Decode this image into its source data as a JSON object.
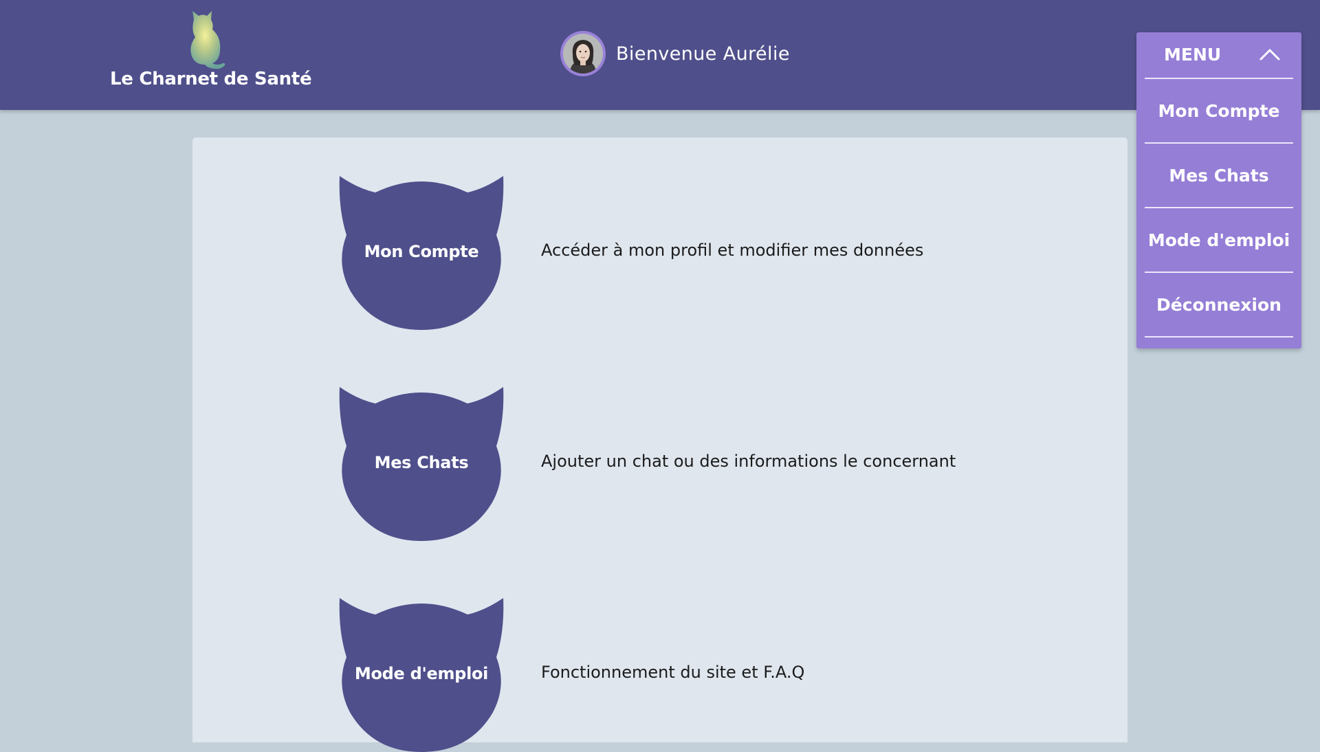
{
  "header": {
    "brand": "Le Charnet de Santé",
    "welcome": "Bienvenue Aurélie"
  },
  "menu": {
    "title": "MENU",
    "items": [
      {
        "label": "Mon Compte"
      },
      {
        "label": "Mes Chats"
      },
      {
        "label": "Mode d'emploi"
      },
      {
        "label": "Déconnexion"
      }
    ]
  },
  "cards": [
    {
      "label": "Mon Compte",
      "description": "Accéder à mon profil et modifier mes données"
    },
    {
      "label": "Mes Chats",
      "description": "Ajouter un chat ou des informations le concernant"
    },
    {
      "label": "Mode d'emploi",
      "description": "Fonctionnement du site et F.A.Q"
    }
  ],
  "colors": {
    "header": "#4f4f8b",
    "menu": "#957ed6",
    "cat_button": "#4f4f8b",
    "page_bg": "#c3d0da",
    "panel_bg": "#dfe6ee"
  },
  "icons": {
    "logo": "cat-logo-icon",
    "menu_toggle": "chevron-up-icon",
    "card_shape": "cat-head-icon"
  }
}
